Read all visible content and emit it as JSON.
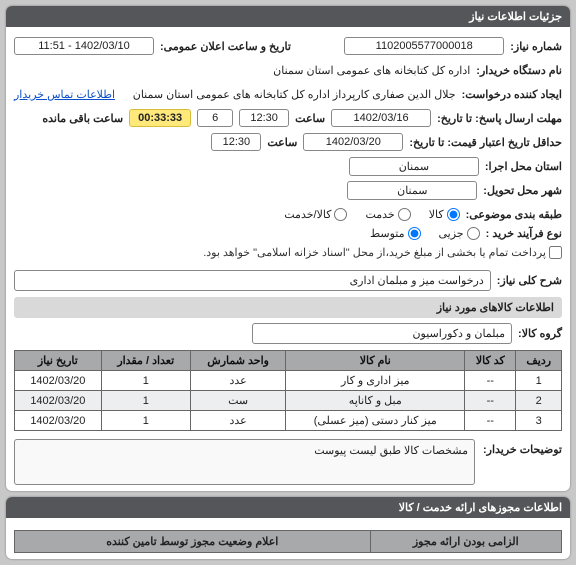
{
  "headers": {
    "details": "جزئیات اطلاعات نیاز"
  },
  "labels": {
    "need_no": "شماره نیاز:",
    "announce_date": "تاریخ و ساعت اعلان عمومی:",
    "buyer_org": "نام دستگاه خریدار:",
    "requester": "ایجاد کننده درخواست:",
    "contact": "اطلاعات تماس خریدار",
    "reply_deadline": "مهلت ارسال پاسخ: تا تاریخ:",
    "hour": "ساعت",
    "remaining": "ساعت باقی مانده",
    "min_validity": "حداقل تاریخ اعتبار قیمت: تا تاریخ:",
    "exec_province": "استان محل اجرا:",
    "delivery_city": "شهر محل تحویل:",
    "subject_class": "طبقه بندی موضوعی:",
    "buy_process": "نوع فرآیند خرید :",
    "payment_note": "پرداخت تمام یا بخشی از مبلغ خرید،از محل \"اسناد خزانه اسلامی\" خواهد بود.",
    "need_desc": "شرح کلی نیاز:",
    "goods_info": "اطلاعات کالاهای مورد نیاز",
    "goods_group": "گروه کالا:",
    "buyer_notes": "توضیحات خریدار:",
    "licenses": "اطلاعات مجوزهای ارائه خدمت / کالا"
  },
  "values": {
    "need_no": "1102005577000018",
    "announce_date": "1402/03/10 - 11:51",
    "buyer_org": "اداره کل کتابخانه های عمومی استان سمنان",
    "requester": "جلال الدین صفاری کارپرداز اداره کل کتابخانه های عمومی استان سمنان",
    "reply_date": "1402/03/16",
    "reply_hour": "12:30",
    "reply_days": "6",
    "countdown": "00:33:33",
    "validity_date": "1402/03/20",
    "validity_hour": "12:30",
    "exec_province": "سمنان",
    "delivery_city": "سمنان",
    "need_desc": "درخواست میز و مبلمان اداری",
    "goods_group": "مبلمان و دکوراسیون",
    "spec_note": "مشخصات کالا طبق لیست پیوست"
  },
  "class_options": {
    "kala": "کالا",
    "khadamat": "خدمت",
    "both": "کالا/خدمت"
  },
  "process_options": {
    "partial": "جزیی",
    "medium": "متوسط"
  },
  "table": {
    "headers": {
      "row": "ردیف",
      "code": "کد کالا",
      "name": "نام کالا",
      "unit": "واحد شمارش",
      "qty": "تعداد / مقدار",
      "date": "تاریخ نیاز"
    },
    "rows": [
      {
        "row": "1",
        "code": "--",
        "name": "میز اداری و کار",
        "unit": "عدد",
        "qty": "1",
        "date": "1402/03/20"
      },
      {
        "row": "2",
        "code": "--",
        "name": "مبل و کاناپه",
        "unit": "ست",
        "qty": "1",
        "date": "1402/03/20"
      },
      {
        "row": "3",
        "code": "--",
        "name": "میز کنار دستی (میز عسلی)",
        "unit": "عدد",
        "qty": "1",
        "date": "1402/03/20"
      }
    ]
  },
  "lic_table": {
    "headers": {
      "needed": "الزامی بودن ارائه مجوز",
      "declare": "اعلام وضعیت مجوز توسط تامین کننده"
    }
  }
}
